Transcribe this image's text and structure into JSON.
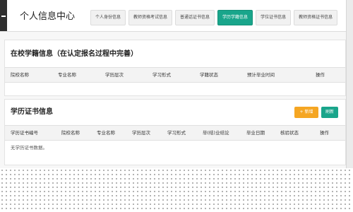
{
  "header": {
    "title": "个人信息中心",
    "tabs": [
      "个人身份信息",
      "教师资格考试信息",
      "普通话证书信息",
      "学历学籍信息",
      "学位证书信息",
      "教师资格证书信息"
    ],
    "active_tab": "学历学籍信息"
  },
  "school_status": {
    "title": "在校学籍信息（在认定报名过程中完善）",
    "columns": [
      "院校名称",
      "专业名称",
      "学历层次",
      "学习形式",
      "学籍状态",
      "预计毕业时间",
      "操作"
    ]
  },
  "education_cert": {
    "title": "学历证书信息",
    "add_label": "+ 新增",
    "refresh_label": "刷新",
    "columns": [
      "学历证书编号",
      "院校名称",
      "专业名称",
      "学历层次",
      "学习形式",
      "毕(结)业结论",
      "毕业日期",
      "核验状态",
      "操作"
    ],
    "empty_text": "无学历证书数据。"
  },
  "colors": {
    "active_tab": "#19a58b",
    "add_button": "#f5a623",
    "refresh_button": "#19a58b"
  }
}
